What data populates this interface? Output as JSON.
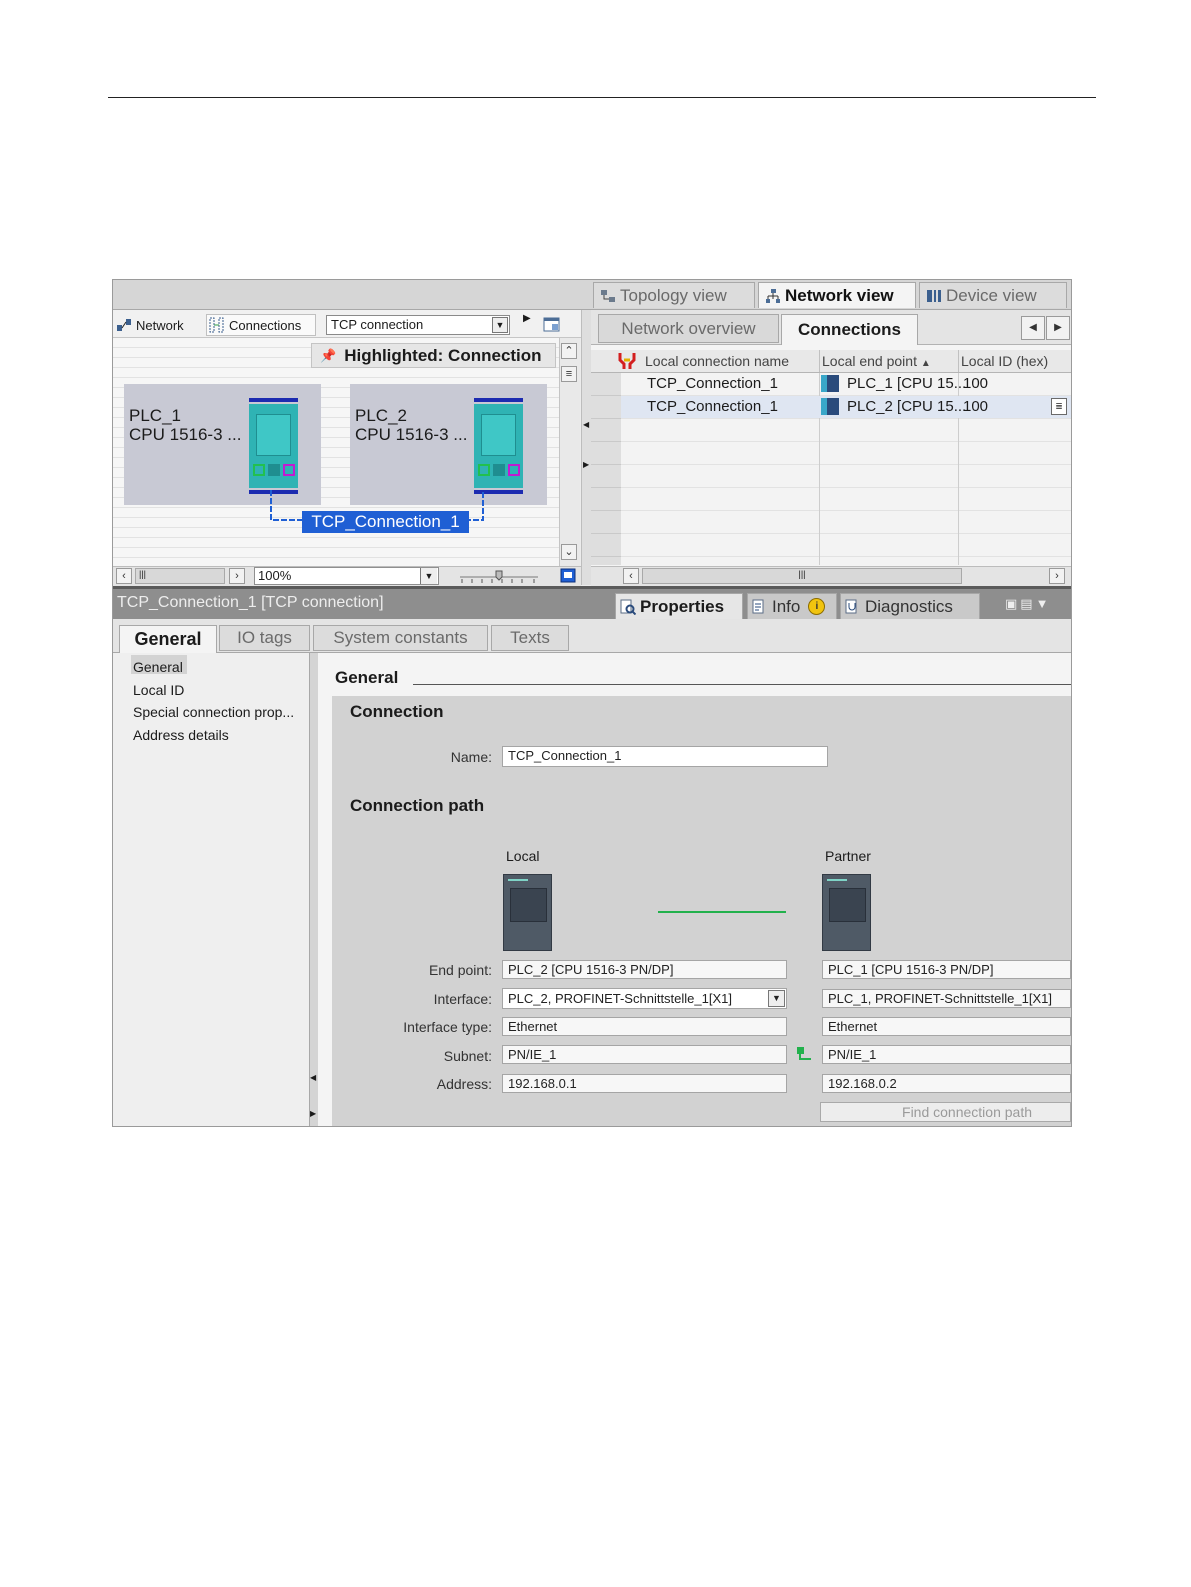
{
  "views": {
    "topology": "Topology view",
    "network": "Network view",
    "device": "Device view"
  },
  "toolbar": {
    "network_label": "Network",
    "connections_label": "Connections",
    "connection_type": "TCP connection",
    "highlighted": "Highlighted: Connection"
  },
  "canvas": {
    "plc1": {
      "name": "PLC_1",
      "cpu": "CPU 1516-3 ..."
    },
    "plc2": {
      "name": "PLC_2",
      "cpu": "CPU 1516-3 ..."
    },
    "connection_label": "TCP_Connection_1",
    "zoom": "100%"
  },
  "right_tabs": {
    "overview": "Network overview",
    "connections": "Connections"
  },
  "table": {
    "headers": [
      "Local connection name",
      "Local end point",
      "Local ID (hex)"
    ],
    "rows": [
      {
        "name": "TCP_Connection_1",
        "endpoint": "PLC_1 [CPU 15...",
        "id": "100"
      },
      {
        "name": "TCP_Connection_1",
        "endpoint": "PLC_2 [CPU 15...",
        "id": "100"
      }
    ]
  },
  "inspector": {
    "title": "TCP_Connection_1 [TCP connection]",
    "properties": "Properties",
    "info": "Info",
    "diagnostics": "Diagnostics",
    "tabs": [
      "General",
      "IO tags",
      "System constants",
      "Texts"
    ],
    "nav": [
      "General",
      "Local ID",
      "Special connection prop...",
      "Address details"
    ],
    "section_general": "General",
    "section_connection": "Connection",
    "name_label": "Name:",
    "name_value": "TCP_Connection_1",
    "section_path": "Connection path",
    "local_label": "Local",
    "partner_label": "Partner",
    "rows": {
      "endpoint_label": "End point:",
      "interface_label": "Interface:",
      "interface_type_label": "Interface type:",
      "subnet_label": "Subnet:",
      "address_label": "Address:"
    },
    "local": {
      "endpoint": "PLC_2 [CPU 1516-3 PN/DP]",
      "interface": "PLC_2, PROFINET-Schnittstelle_1[X1]",
      "interface_type": "Ethernet",
      "subnet": "PN/IE_1",
      "address": "192.168.0.1"
    },
    "partner": {
      "endpoint": "PLC_1 [CPU 1516-3 PN/DP]",
      "interface": "PLC_1, PROFINET-Schnittstelle_1[X1]",
      "interface_type": "Ethernet",
      "subnet": "PN/IE_1",
      "address": "192.168.0.2"
    },
    "find_path": "Find connection path"
  },
  "colors": {
    "highlight": "#1f5fd4",
    "plc_teal": "#2fb3b4",
    "link_green": "#22b14c"
  }
}
